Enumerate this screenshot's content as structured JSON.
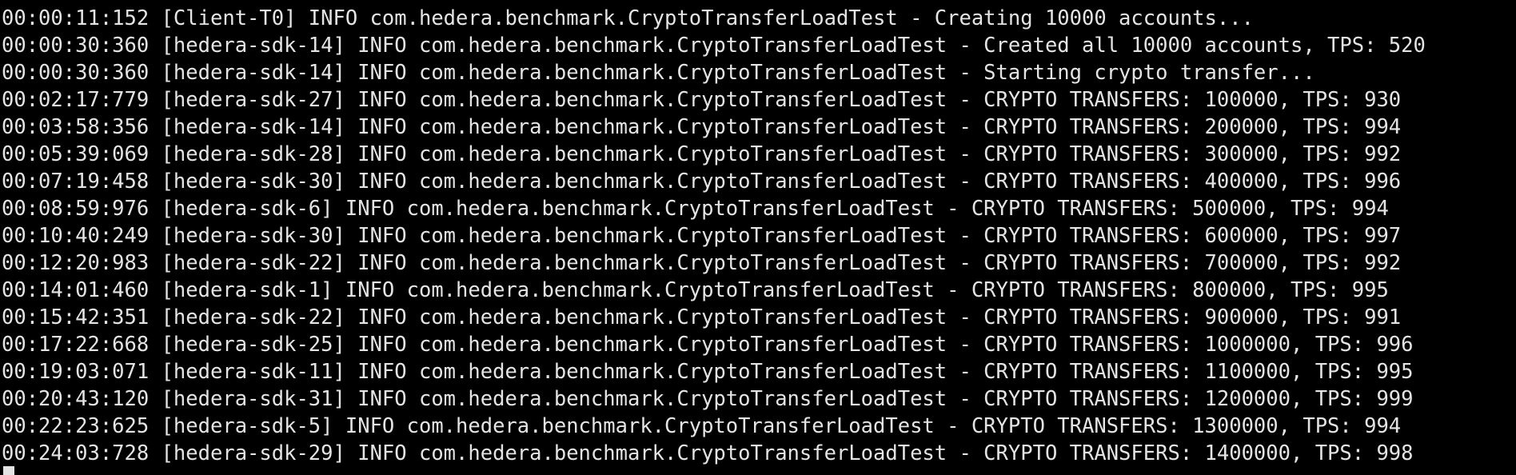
{
  "terminal": {
    "lines": [
      "00:00:11:152 [Client-T0] INFO com.hedera.benchmark.CryptoTransferLoadTest - Creating 10000 accounts...",
      "00:00:30:360 [hedera-sdk-14] INFO com.hedera.benchmark.CryptoTransferLoadTest - Created all 10000 accounts, TPS: 520",
      "00:00:30:360 [hedera-sdk-14] INFO com.hedera.benchmark.CryptoTransferLoadTest - Starting crypto transfer...",
      "00:02:17:779 [hedera-sdk-27] INFO com.hedera.benchmark.CryptoTransferLoadTest - CRYPTO TRANSFERS: 100000, TPS: 930",
      "00:03:58:356 [hedera-sdk-14] INFO com.hedera.benchmark.CryptoTransferLoadTest - CRYPTO TRANSFERS: 200000, TPS: 994",
      "00:05:39:069 [hedera-sdk-28] INFO com.hedera.benchmark.CryptoTransferLoadTest - CRYPTO TRANSFERS: 300000, TPS: 992",
      "00:07:19:458 [hedera-sdk-30] INFO com.hedera.benchmark.CryptoTransferLoadTest - CRYPTO TRANSFERS: 400000, TPS: 996",
      "00:08:59:976 [hedera-sdk-6] INFO com.hedera.benchmark.CryptoTransferLoadTest - CRYPTO TRANSFERS: 500000, TPS: 994",
      "00:10:40:249 [hedera-sdk-30] INFO com.hedera.benchmark.CryptoTransferLoadTest - CRYPTO TRANSFERS: 600000, TPS: 997",
      "00:12:20:983 [hedera-sdk-22] INFO com.hedera.benchmark.CryptoTransferLoadTest - CRYPTO TRANSFERS: 700000, TPS: 992",
      "00:14:01:460 [hedera-sdk-1] INFO com.hedera.benchmark.CryptoTransferLoadTest - CRYPTO TRANSFERS: 800000, TPS: 995",
      "00:15:42:351 [hedera-sdk-22] INFO com.hedera.benchmark.CryptoTransferLoadTest - CRYPTO TRANSFERS: 900000, TPS: 991",
      "00:17:22:668 [hedera-sdk-25] INFO com.hedera.benchmark.CryptoTransferLoadTest - CRYPTO TRANSFERS: 1000000, TPS: 996",
      "00:19:03:071 [hedera-sdk-11] INFO com.hedera.benchmark.CryptoTransferLoadTest - CRYPTO TRANSFERS: 1100000, TPS: 995",
      "00:20:43:120 [hedera-sdk-31] INFO com.hedera.benchmark.CryptoTransferLoadTest - CRYPTO TRANSFERS: 1200000, TPS: 999",
      "00:22:23:625 [hedera-sdk-5] INFO com.hedera.benchmark.CryptoTransferLoadTest - CRYPTO TRANSFERS: 1300000, TPS: 994",
      "00:24:03:728 [hedera-sdk-29] INFO com.hedera.benchmark.CryptoTransferLoadTest - CRYPTO TRANSFERS: 1400000, TPS: 998"
    ]
  },
  "colors": {
    "background": "#000000",
    "text": "#e4e4e4"
  }
}
